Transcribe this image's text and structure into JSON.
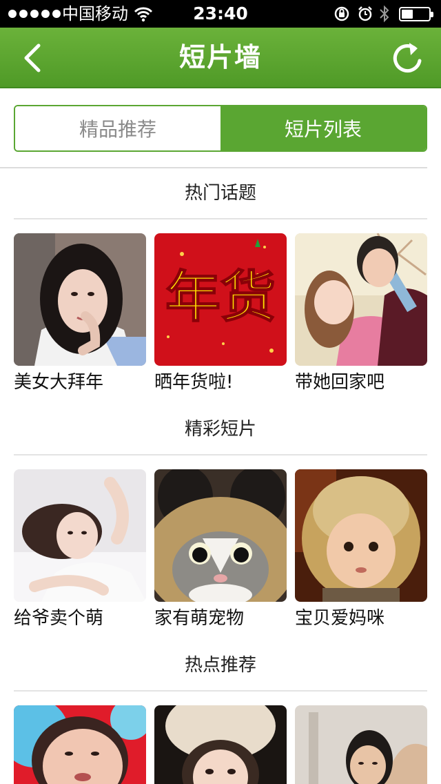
{
  "status_bar": {
    "carrier": "中国移动",
    "time": "23:40"
  },
  "nav": {
    "title": "短片墙",
    "back_icon": "chevron-left-icon",
    "refresh_icon": "refresh-icon"
  },
  "tabs": [
    {
      "label": "精品推荐",
      "active": false
    },
    {
      "label": "短片列表",
      "active": true
    }
  ],
  "sections": [
    {
      "title": "热门话题",
      "items": [
        {
          "caption": "美女大拜年"
        },
        {
          "caption": "晒年货啦!"
        },
        {
          "caption": "带她回家吧"
        }
      ]
    },
    {
      "title": "精彩短片",
      "items": [
        {
          "caption": "给爷卖个萌"
        },
        {
          "caption": "家有萌宠物"
        },
        {
          "caption": "宝贝爱妈咪"
        }
      ]
    },
    {
      "title": "热点推荐",
      "items": [
        {
          "caption": ""
        },
        {
          "caption": ""
        },
        {
          "caption": ""
        }
      ]
    }
  ],
  "poster_text": "年货",
  "colors": {
    "accent": "#5aa632",
    "nav_bar": "#5ca72e"
  }
}
